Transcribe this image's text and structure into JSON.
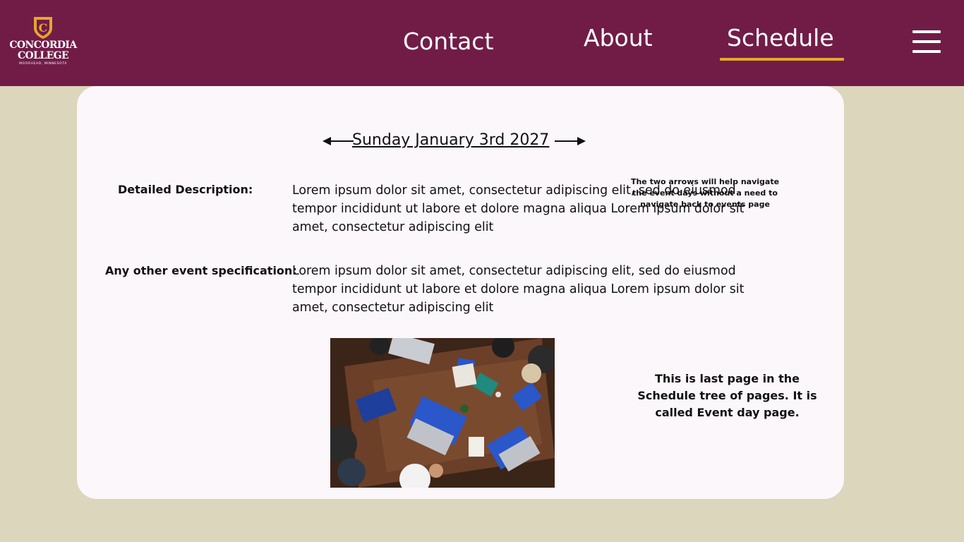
{
  "logo": {
    "line1": "CONCORDIA",
    "line2": "COLLEGE",
    "line3": "MOORHEAD, MINNESOTA",
    "letter": "C"
  },
  "nav": {
    "contact": "Contact",
    "about": "About",
    "schedule": "Schedule",
    "active": "Schedule"
  },
  "event": {
    "date": "Sunday January 3rd 2027",
    "description_label": "Detailed Description:",
    "description_text": "Lorem ipsum dolor sit amet, consectetur adipiscing elit, sed do eiusmod tempor incididunt ut labore et dolore magna aliqua Lorem ipsum dolor sit amet, consectetur adipiscing elit",
    "spec_label": "Any other event specification:",
    "spec_text": "Lorem ipsum dolor sit amet, consectetur adipiscing elit, sed do eiusmod tempor incididunt ut labore et dolore magna aliqua Lorem ipsum dolor sit amet, consectetur adipiscing elit"
  },
  "notes": {
    "arrows_note": "The two arrows will help navigate the event days without a need to navigate back to events page",
    "page_note": "This is last page in the Schedule tree of pages. It is called Event day page."
  },
  "icons": {
    "menu": "hamburger-menu-icon",
    "prev": "arrow-left-icon",
    "next": "arrow-right-icon",
    "logo": "shield-crest-icon"
  },
  "colors": {
    "header": "#711c47",
    "background": "#dcd6bd",
    "card": "#fcf7fb",
    "accent": "#e5a630"
  }
}
